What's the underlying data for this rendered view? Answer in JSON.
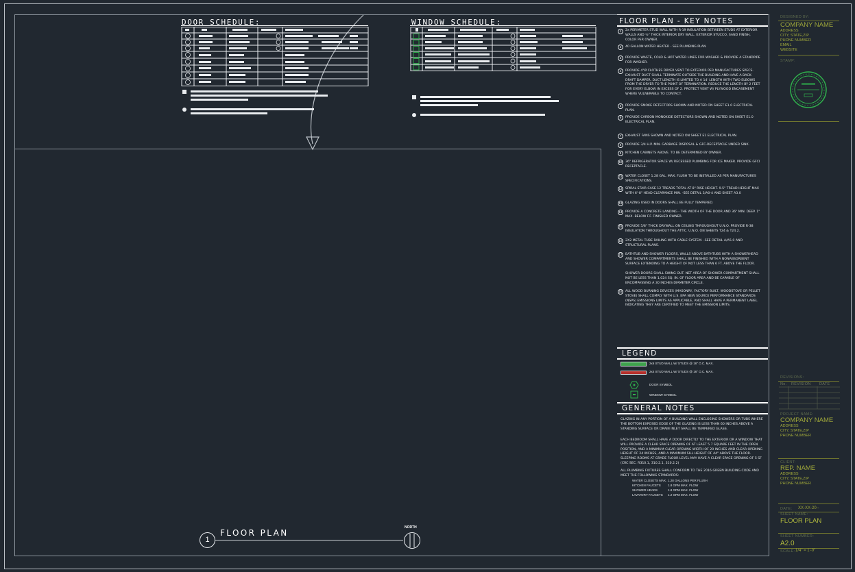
{
  "door_schedule": {
    "title": "DOOR   SCHEDULE:"
  },
  "window_schedule": {
    "title": "WINDOW  SCHEDULE:"
  },
  "key_notes": {
    "title": "FLOOR PLAN - KEY NOTES",
    "items": [
      {
        "num": "1",
        "text": "2x PERIMETER STUD WALL WITH R-19 INSULATION BETWEEN STUDS AT EXTERIOR WALLS AND ½\" THICK INTERIOR DRY WALL. EXTERIOR STUCCO, SAND FINISH, COLOR PER OWNER."
      },
      {
        "num": "2",
        "text": "40 GALLON WATER HEATER - SEE PLUMBING PLAN"
      },
      {
        "num": "3",
        "text": "PROVIDE WASTE, COLD & HOT WATER LINES FOR WASHER & PROVIDE A STANDPIPE FOR WASHER."
      },
      {
        "num": "4",
        "text": "PROVIDE 4\"Ø CLOTHES DRYER VENT TO EXTERIOR PER MANUFACTURES SPECS. EXHAUST DUCT SHALL TERMINATE OUTSIDE THE BUILDING AND HAVE A BACK-DRAFT DAMPER. DUCT LENGTH IS LIMITED TO A 14' LENGTH WITH TWO ELBOWS FROM THE DRYER TO THE POINT OF TERMINATION. REDUCE THE LENGTH BY 2 FEET FOR EVERY ELBOW IN EXCESS OF 2. PROTECT VENT W/ PLYWOOD ENCASEMENT WHERE VULNERABLE TO CONTACT."
      },
      {
        "num": "5",
        "text": "PROVIDE SMOKE DETECTORS SHOWN AND NOTED ON SHEET E1.0 ELECTRICAL PLAN."
      },
      {
        "num": "6",
        "text": "PROVIDE CARBON MONOXIDE DETECTORS SHOWN AND NOTED ON SHEET E1.0 ELECTRICAL PLAN."
      },
      {
        "num": "7",
        "text": "EXHAUST FANS SHOWN AND NOTED ON SHEET E1 ELECTRICAL PLAN."
      },
      {
        "num": "8",
        "text": "PROVIDE 3/4 H.P. MIN. GARBAGE DISPOSAL & GFC-RECEPTACLE UNDER SINK."
      },
      {
        "num": "9",
        "text": "KITCHEN CABINETS ABOVE. TO BE DETERMINED BY OWNER."
      },
      {
        "num": "10",
        "text": "36\" REFRIGERATOR SPACE W/ RECESSED PLUMBING FOR ICE MAKER. PROVIDE GFCI RECEPTACLE."
      },
      {
        "num": "11",
        "text": "WATER CLOSET 1.28 GAL. MAX. FLUSH TO BE INSTALLED AS PER MANUFACTURES SPECIFICATIONS."
      },
      {
        "num": "12",
        "text": "SPIRAL STAIR CASE 12 TREADS TOTAL AT 8\" RISE HEIGHT. 9.5\" TREAD HEIGHT MAX WITH 6'-8\" HEAD CLEARANCE MIN. -SEE DETAIL 3/A0-4 AND SHEET A3.0"
      },
      {
        "num": "13",
        "text": "GLAZING USED IN DOORS SHALL BE FULLY TEMPERED."
      },
      {
        "num": "14",
        "text": "PROVIDE A CONCRETE LANDING - THE WIDTH OF THE DOOR AND 36\" MIN. DEEP. 1\" MAX. BELOW F.F. FINISHED OWNER."
      },
      {
        "num": "15",
        "text": "PROVIDE 5/8\" THICK DRYWALL ON CEILING THROUGHOUT U.N.O. PROVIDE R-38 INSULATION THROUGHOUT THE ATTIC. U.N.O. ON SHEETS T24 & T24.2."
      },
      {
        "num": "16",
        "text": "2X2 METAL TUBE RAILING WITH CABLE SYSTEM. -SEE DETAIL A/A5.0 AND STRUCTURAL PLANS."
      },
      {
        "num": "17",
        "text": "BATHTUB AND SHOWER FLOORS, WALLS ABOVE BATHTUBS WITH A SHOWERHEAD AND SHOWER COMPARTMENTS SHALL BE FINISHED WITH A NONABSORBENT SURFACE EXTENDING TO A HEIGHT OF NOT LESS THAN 6 FT. ABOVE THE FLOOR."
      },
      {
        "num": "",
        "text": "SHOWER DOORS SHALL SWING OUT. NET AREA OF SHOWER COMPARTMENT SHALL NOT BE LESS THAN 1,024 SQ. IN. OF FLOOR AREA AND BE CAPABLE OF ENCOMPASSING A 30 INCHES DIAMETER CIRCLE."
      },
      {
        "num": "18",
        "text": "ALL WOOD BURNING DEVICES (MASONRY, FACTORY BUILT, WOODSTOVE OR PELLET STOVE) SHALL COMPLY WITH U.S. EPA NEW SOURCE PERFORMANCE STANDARDS (NSPS) EMISSIONS LIMITS AS APPLICABLE, AND SHALL HAVE A PERMANENT LABEL INDICATING THEY ARE CERTIFIED TO MEET THE EMISSION LIMITS."
      }
    ]
  },
  "legend": {
    "title": "LEGEND",
    "items": [
      {
        "swatch_color": "#3fa34d",
        "label": "2x6 STUD WALL W/ STUDS @ 16\" O.C. MAX."
      },
      {
        "swatch_color": "#b7312c",
        "label": "2x4 STUD WALL W/ STUDS @ 16\" O.C. MAX."
      },
      {
        "icon": "door-symbol-icon",
        "label": "DOOR SYMBOL"
      },
      {
        "icon": "window-symbol-icon",
        "label": "WINDOW SYMBOL"
      }
    ]
  },
  "general_notes": {
    "title": "GENERAL NOTES",
    "paragraphs": [
      "GLAZING IN ANY PORTION OF A BUILDING WALL ENCLOSING SHOWERS OR TUBS WHERE THE BOTTOM EXPOSED EDGE OF THE GLAZING IS LESS THAN 60 INCHES ABOVE A STANDING SURFACE OR DRAIN INLET SHALL BE TEMPERED GLASS.",
      "EACH BEDROOM SHALL HAVE A DOOR DIRECTLY TO THE EXTERIOR OR A WINDOW THAT WILL PROVIDE A CLEAR SPACE OPENING OF AT LEAST 5.7 SQUARE FEET IN THE OPEN POSITION, AND A MINIMUM CLEAR OPENING WIDTH OF 20 INCHES AND CLEAR OPENING HEIGHT OF 24 INCHES, AND A MAXIMUM SILL HEIGHT OF 44\" ABOVE THE FLOOR. SLEEPING ROOMS AT GRADE FLOOR LEVEL MAY HAVE A CLEAR SPACE OPENING OF 5 SF (CRC SEC. R310.1, 310.2.1, 310.2.2)",
      "ALL PLUMBING FIXTURES SHALL CONFORM TO THE 2016 GREEN BUILDING CODE AND MEET THE FOLLOWING STANDARDS:"
    ],
    "fixtures": [
      {
        "name": "WATER CLOSETS MAX.",
        "value": "1.28 GALLONS PER FLUSH"
      },
      {
        "name": "KITCHEN FAUCETS",
        "value": "1.8 GPM MAX. FLOW"
      },
      {
        "name": "SHOWER HEADS",
        "value": "1.8 GPM MAX. FLOW"
      },
      {
        "name": "LAVATORY FAUCETS",
        "value": "1.2 GPM MAX. FLOW"
      }
    ]
  },
  "drawing": {
    "number": "1",
    "title": "FLOOR PLAN",
    "north_label": "NORTH"
  },
  "title_block": {
    "designed_by_label": "DESIGNED BY:",
    "company_name": "COMPANY NAME",
    "company_lines": [
      "ADDRESS",
      "CITY, STATE,ZIP",
      "PHONE NUMBER",
      "EMAIL",
      "WEBSITE"
    ],
    "stamp_label": "STAMP:",
    "revisions_label": "REVISIONS:",
    "rev_headers": [
      "No.",
      "REVISION",
      "DATE"
    ],
    "project_label": "PROJECT NAME:",
    "project_name": "COMPANY NAME",
    "project_lines": [
      "ADDRESS",
      "CITY, STATE,ZIP",
      "PHONE NUMBER"
    ],
    "client_label": "CLIENT:",
    "client_name": "REP. NAME",
    "client_lines": [
      "ADDRESS",
      "CITY, STATE,ZIP",
      "PHONE NUMBER"
    ],
    "date_label": "DATE:",
    "date_value": "XX-XX-20--",
    "sheet_name_label": "SHEET NAME:",
    "sheet_name": "FLOOR PLAN",
    "sheet_number_label": "SHEET NUMBER:",
    "sheet_number": "A2.0",
    "scale_label": "SCALE:",
    "scale_value": "1/4\" = 1'-0\""
  },
  "colors": {
    "background": "#212830",
    "line": "#8e969e",
    "olive": "#9fa73a",
    "stamp": "#2fb24c"
  }
}
